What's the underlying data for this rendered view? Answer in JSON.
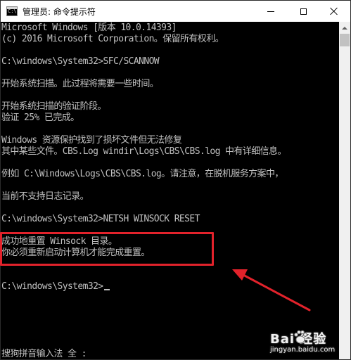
{
  "window": {
    "title": "管理员: 命令提示符",
    "icon_label": "C:\\",
    "icons": [
      "cmd-app-icon",
      "minimize-icon",
      "maximize-icon",
      "close-icon"
    ]
  },
  "console": {
    "lines": [
      "Microsoft Windows [版本 10.0.14393]",
      "(c) 2016 Microsoft Corporation。保留所有权利。",
      "",
      "C:\\windows\\System32>SFC/SCANNOW",
      "",
      "开始系统扫描。此过程将需要一些时间。",
      "",
      "开始系统扫描的验证阶段。",
      "验证 25% 已完成。",
      "",
      "Windows 资源保护找到了损坏文件但无法修复",
      "其中某些文件。CBS.Log windir\\Logs\\CBS\\CBS.log 中有详细信息。",
      "",
      "例如 C:\\Windows\\Logs\\CBS\\CBS.log。请注意，在脱机服务方案中，",
      "",
      "当前不支持日志记录。",
      "",
      "C:\\windows\\System32>NETSH WINSOCK RESET",
      "",
      "成功地重置 Winsock 目录。",
      "你必须重新启动计算机才能完成重置。",
      "",
      "",
      "C:\\windows\\System32>",
      "",
      "",
      "",
      "",
      "",
      "搜狗拼音输入法 全 :"
    ]
  },
  "annotation": {
    "box_color": "#e2222b",
    "arrow_color": "#e2222b"
  },
  "watermark": {
    "brand": "Bai 经验",
    "url": "jingyan.baidu.com"
  }
}
